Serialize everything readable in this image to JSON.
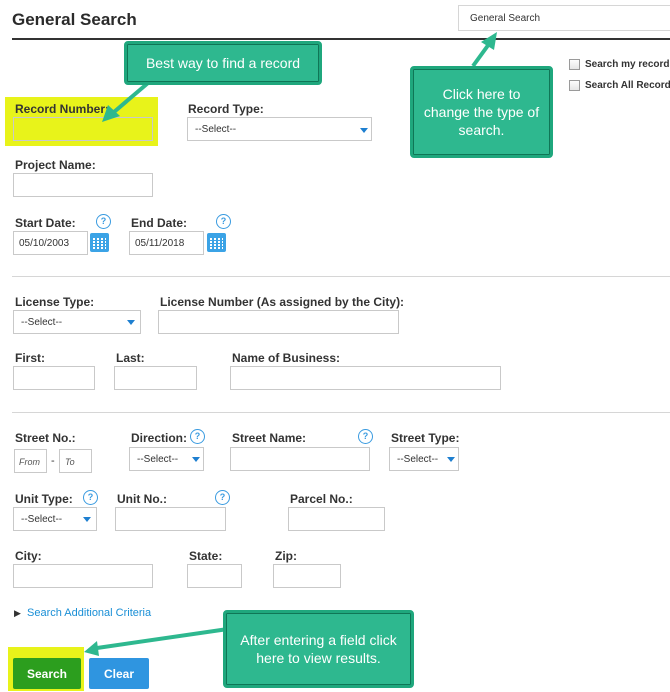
{
  "header": {
    "title": "General Search",
    "search_type": "General Search"
  },
  "options": {
    "search_my": "Search my records",
    "search_all": "Search All Records"
  },
  "fields": {
    "record_number": "Record Number:",
    "record_type": "Record Type:",
    "record_type_value": "--Select--",
    "project_name": "Project Name:",
    "start_date": "Start Date:",
    "start_date_value": "05/10/2003",
    "end_date": "End Date:",
    "end_date_value": "05/11/2018",
    "license_type": "License Type:",
    "license_type_value": "--Select--",
    "license_number": "License Number (As assigned by the City):",
    "first": "First:",
    "last": "Last:",
    "business": "Name of Business:",
    "street_no": "Street No.:",
    "from_ph": "From",
    "dash": "-",
    "to_ph": "To",
    "direction": "Direction:",
    "direction_value": "--Select--",
    "street_name": "Street Name:",
    "street_type": "Street Type:",
    "street_type_value": "--Select--",
    "unit_type": "Unit Type:",
    "unit_type_value": "--Select--",
    "unit_no": "Unit No.:",
    "parcel_no": "Parcel No.:",
    "city": "City:",
    "state": "State:",
    "zip": "Zip:"
  },
  "help_glyph": "?",
  "additional": {
    "arrow": "▶",
    "label": "Search Additional Criteria"
  },
  "buttons": {
    "search": "Search",
    "clear": "Clear"
  },
  "callouts": {
    "best_way": "Best way to find a record",
    "change_type": "Click here to change the type of search.",
    "after_entering": "After entering a field click here to view results."
  },
  "colors": {
    "accent": "#1a8fd6",
    "highlight": "#e8f31a",
    "callout": "#2eb88f",
    "search_button": "#2c9e1e"
  }
}
